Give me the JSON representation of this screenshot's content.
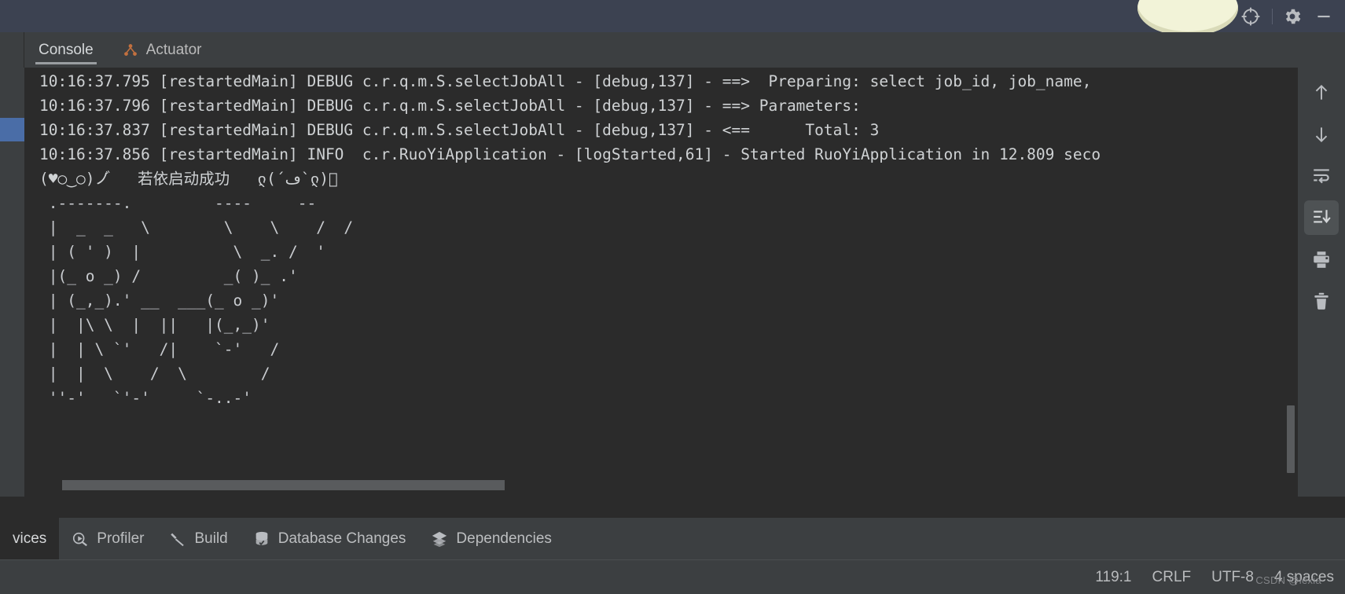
{
  "titlebar": {
    "icons": [
      {
        "name": "avatar",
        "label": "user-avatar"
      },
      {
        "name": "target-icon",
        "label": "Locate"
      },
      {
        "name": "gear-icon",
        "label": "Settings"
      },
      {
        "name": "minimize-icon",
        "label": "Minimize"
      }
    ]
  },
  "tabs": [
    {
      "label": "Console",
      "active": true,
      "icon": ""
    },
    {
      "label": "Actuator",
      "active": false,
      "icon": "actuator-icon"
    }
  ],
  "console": {
    "lines": [
      "10:16:37.795 [restartedMain] DEBUG c.r.q.m.S.selectJobAll - [debug,137] - ==>  Preparing: select job_id, job_name,",
      "10:16:37.796 [restartedMain] DEBUG c.r.q.m.S.selectJobAll - [debug,137] - ==> Parameters:",
      "10:16:37.837 [restartedMain] DEBUG c.r.q.m.S.selectJobAll - [debug,137] - <==      Total: 3",
      "10:16:37.856 [restartedMain] INFO  c.r.RuoYiApplication - [logStarted,61] - Started RuoYiApplication in 12.809 seco"
    ],
    "banner": "(♥○‿○)ノ゙   若依启动成功   ლ(´ڡ`ლ)゙",
    "ascii_art": [
      " .-------.         ----     --",
      " |  _  _   \\        \\    \\    /  /",
      " | ( ' )  |          \\  _. /  '",
      " |(_ o _) /         _( )_ .'",
      " | (_,_).' __  ___(_ o _)'",
      " |  |\\ \\  |  ||   |(_,_)'",
      " |  | \\ `'   /|    `-'   /",
      " |  |  \\    /  \\        /",
      " ''-'   `'-'     `-..-'"
    ]
  },
  "right_toolbar": [
    {
      "name": "arrow-up-icon",
      "label": "Up",
      "selected": false
    },
    {
      "name": "arrow-down-icon",
      "label": "Down",
      "selected": false
    },
    {
      "name": "soft-wrap-icon",
      "label": "Soft-Wrap",
      "selected": false
    },
    {
      "name": "scroll-to-end-icon",
      "label": "Scroll to End",
      "selected": true
    },
    {
      "name": "print-icon",
      "label": "Print",
      "selected": false
    },
    {
      "name": "trash-icon",
      "label": "Clear All",
      "selected": false
    }
  ],
  "bottom_tabs": [
    {
      "label": "vices",
      "icon": "",
      "active": true
    },
    {
      "label": "Profiler",
      "icon": "profiler-icon",
      "active": false
    },
    {
      "label": "Build",
      "icon": "build-hammer-icon",
      "active": false
    },
    {
      "label": "Database Changes",
      "icon": "database-icon",
      "active": false
    },
    {
      "label": "Dependencies",
      "icon": "layers-icon",
      "active": false
    }
  ],
  "statusbar": {
    "caret": "119:1",
    "line_separator": "CRLF",
    "encoding": "UTF-8",
    "indent": "4 spaces",
    "watermark": "CSDN @lexia"
  },
  "colors": {
    "titlebar_bg": "#3c4251",
    "panel_bg": "#3c3f41",
    "console_bg": "#2b2b2b",
    "text": "#cfd2d4",
    "accent_orange": "#c2703f",
    "selection_blue": "#4a6da7"
  }
}
